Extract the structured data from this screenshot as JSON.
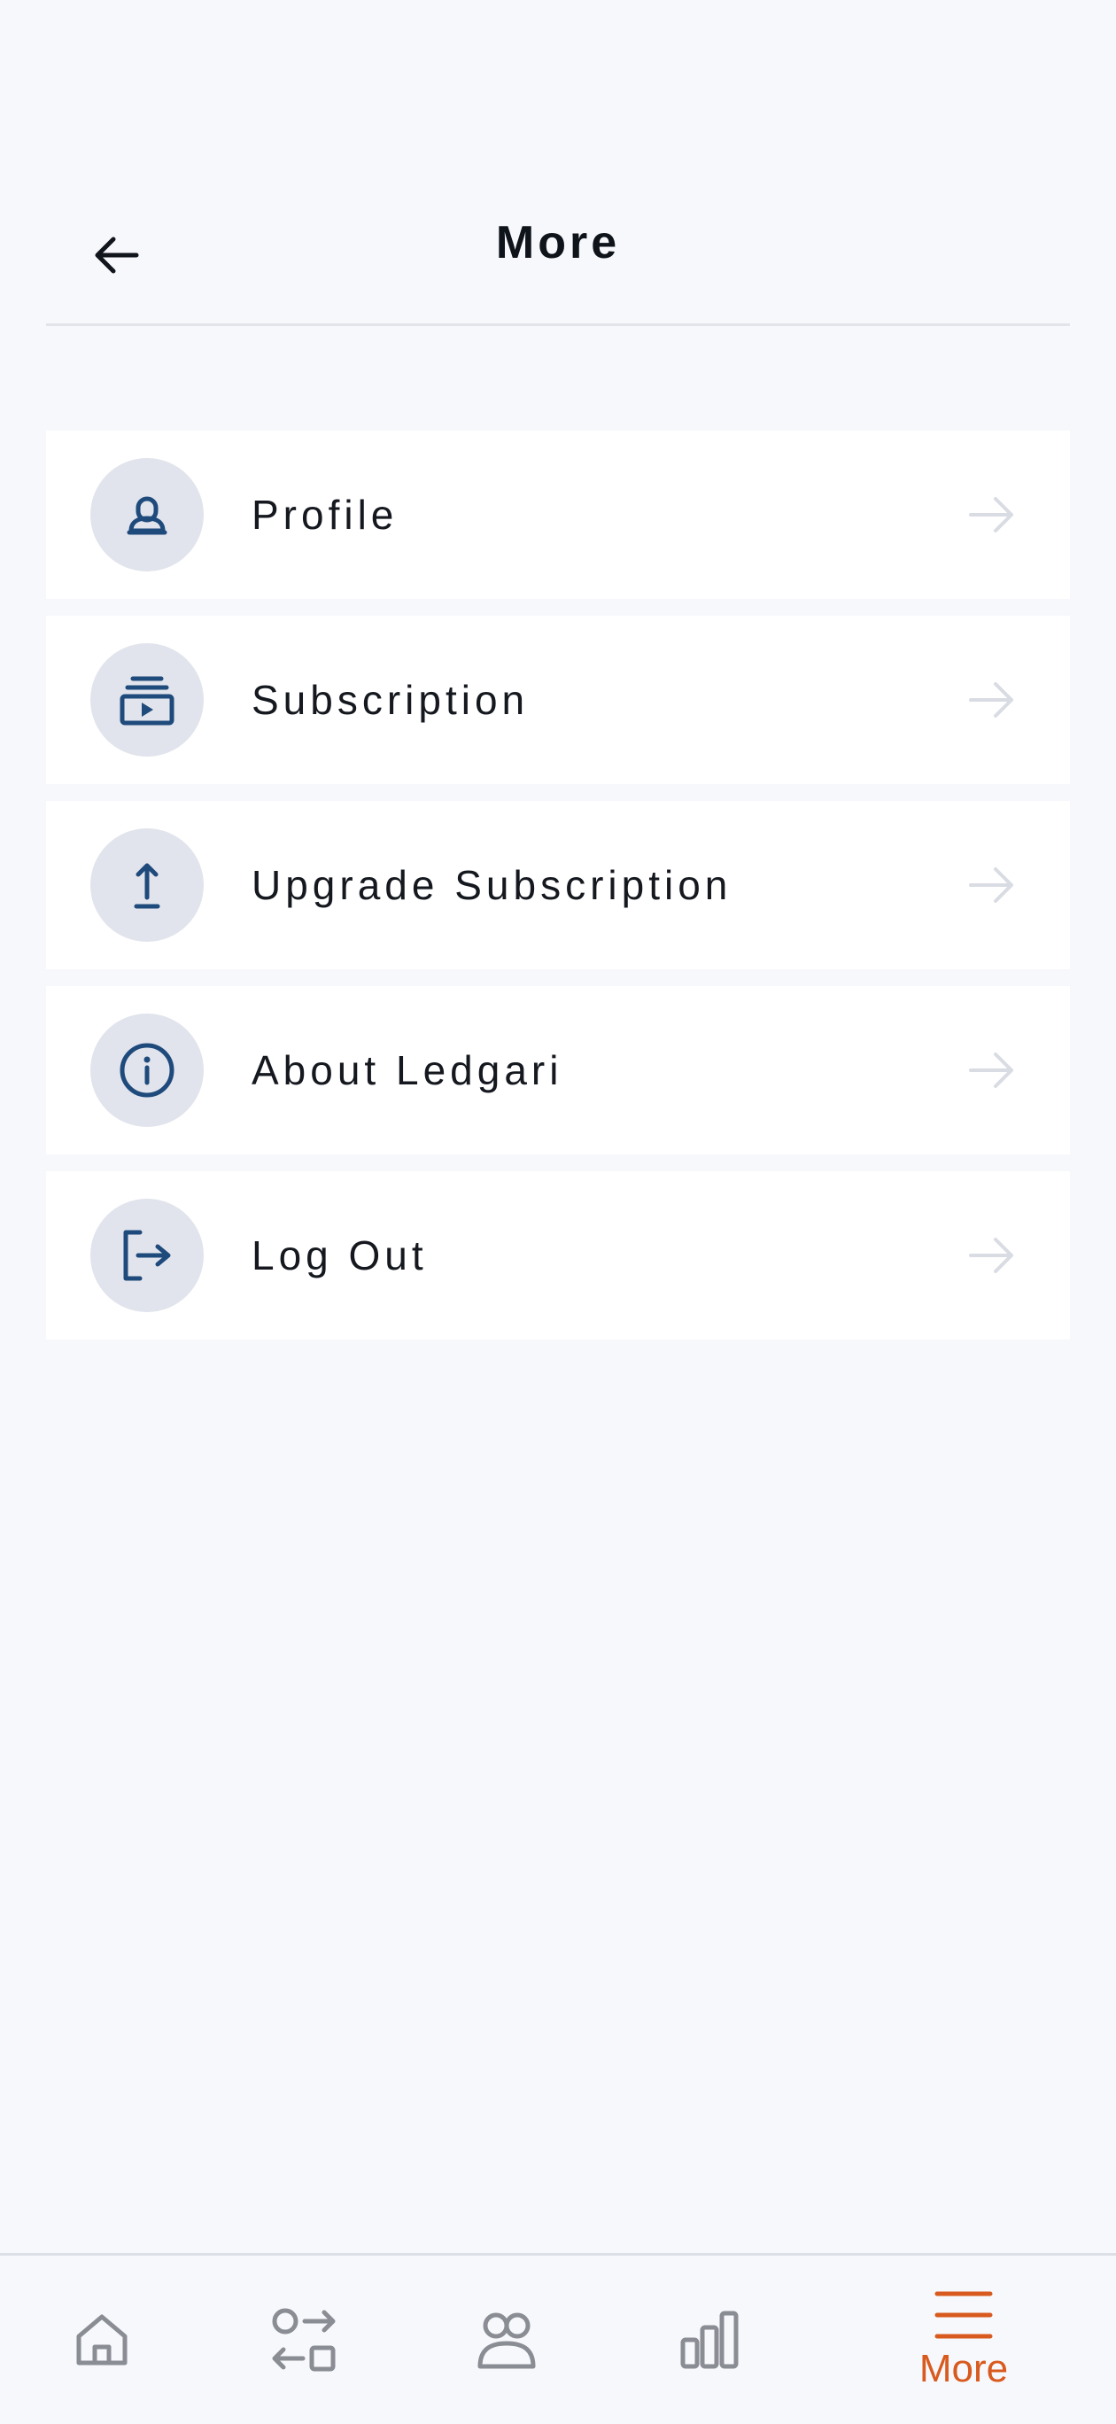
{
  "header": {
    "title": "More"
  },
  "menu": {
    "items": [
      {
        "label": "Profile",
        "icon": "user-icon"
      },
      {
        "label": "Subscription",
        "icon": "subscription-icon"
      },
      {
        "label": "Upgrade Subscription",
        "icon": "upload-icon"
      },
      {
        "label": "About Ledgari",
        "icon": "info-icon"
      },
      {
        "label": "Log Out",
        "icon": "logout-icon"
      }
    ]
  },
  "bottom_nav": {
    "items": [
      {
        "icon": "home-icon",
        "active": false
      },
      {
        "icon": "transfer-icon",
        "active": false
      },
      {
        "icon": "users-icon",
        "active": false
      },
      {
        "icon": "chart-icon",
        "active": false
      },
      {
        "icon": "menu-icon",
        "label": "More",
        "active": true
      }
    ]
  },
  "colors": {
    "icon": "#1f4a7c",
    "accent": "#d85a1e",
    "nav_inactive": "#8a8d93",
    "arrow": "#d9dce3",
    "background": "#f7f8fc"
  }
}
